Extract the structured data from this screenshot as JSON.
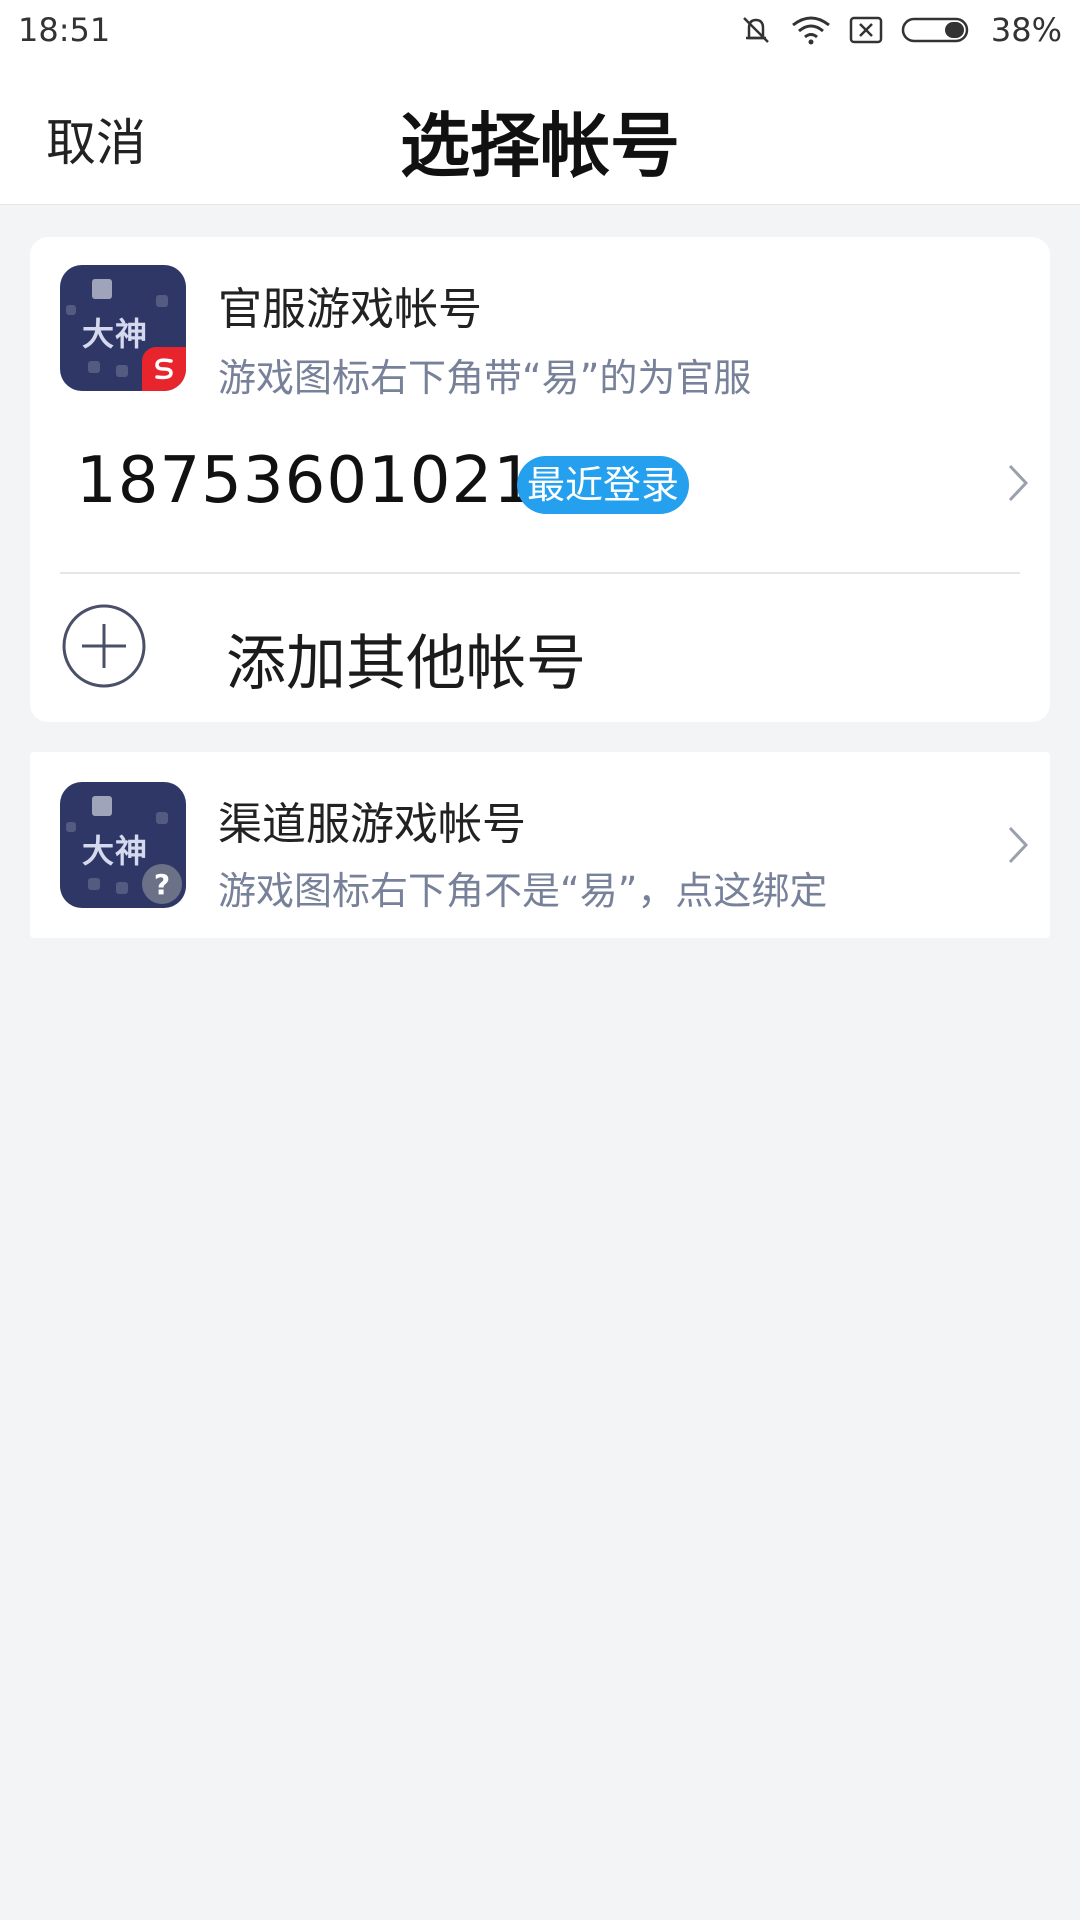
{
  "status_bar": {
    "time": "18:51",
    "icons": [
      "mute-icon",
      "wifi-icon",
      "sim-off-icon",
      "battery-icon"
    ],
    "battery_percent": "38%",
    "battery_level": 0.38
  },
  "header": {
    "cancel_label": "取消",
    "title": "选择帐号"
  },
  "official_section": {
    "icon_text": "大神",
    "title": "官服游戏帐号",
    "subtitle": "游戏图标右下角带“易”的为官服",
    "account": {
      "number": "18753601021",
      "badge": "最近登录"
    },
    "add_label": "添加其他帐号"
  },
  "channel_section": {
    "icon_text": "大神",
    "badge_symbol": "?",
    "title": "渠道服游戏帐号",
    "subtitle": "游戏图标右下角不是“易”，点这绑定"
  },
  "colors": {
    "accent": "#24a0ee",
    "official_badge": "#e8242c",
    "icon_bg": "#2e3766",
    "page_bg": "#f3f4f6"
  }
}
